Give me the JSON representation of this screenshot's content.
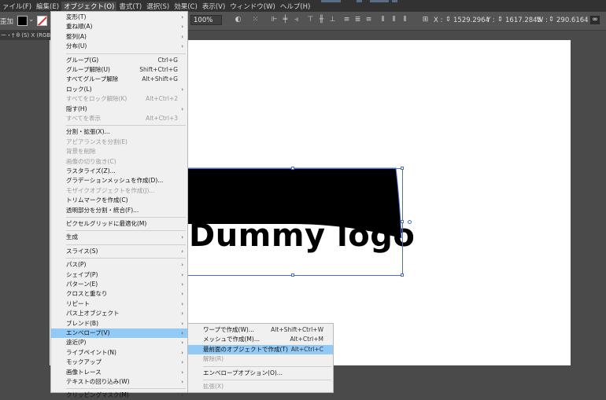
{
  "menubar": {
    "items": [
      {
        "label": "ァイル(F)"
      },
      {
        "label": "編集(E)"
      },
      {
        "label": "オブジェクト(O)",
        "active": true
      },
      {
        "label": "書式(T)"
      },
      {
        "label": "選択(S)"
      },
      {
        "label": "効果(C)"
      },
      {
        "label": "表示(V)"
      },
      {
        "label": "ウィンドウ(W)"
      },
      {
        "label": "ヘルプ(H)"
      }
    ]
  },
  "controlbar": {
    "label_left": "歪加",
    "zoom": "100%",
    "x_label": "X :",
    "x_value": "1529.2964",
    "y_label": "Y :",
    "y_value": "1617.2845",
    "w_label": "W :",
    "w_value": "290.6164"
  },
  "doc_tab": {
    "label": "ー・† θ (S) X (RGB/ブ"
  },
  "artwork": {
    "text": "Dummy logo",
    "shape_color": "#000000",
    "selection_color": "#4a6cd4"
  },
  "object_menu": {
    "items": [
      {
        "label": "変形(T)",
        "submenu": true
      },
      {
        "label": "重ね順(A)",
        "submenu": true
      },
      {
        "label": "整列(A)",
        "submenu": true
      },
      {
        "label": "分布(U)",
        "submenu": true
      },
      {
        "sep": true
      },
      {
        "label": "グループ(G)",
        "shortcut": "Ctrl+G"
      },
      {
        "label": "グループ解除(U)",
        "shortcut": "Shift+Ctrl+G"
      },
      {
        "label": "すべてグループ解除",
        "shortcut": "Alt+Shift+G"
      },
      {
        "label": "ロック(L)",
        "submenu": true
      },
      {
        "label": "すべてをロック解除(K)",
        "shortcut": "Alt+Ctrl+2",
        "disabled": true
      },
      {
        "label": "隠す(H)",
        "submenu": true
      },
      {
        "label": "すべてを表示",
        "shortcut": "Alt+Ctrl+3",
        "disabled": true
      },
      {
        "sep": true
      },
      {
        "label": "分割・拡張(X)..."
      },
      {
        "label": "アピアランスを分割(E)",
        "disabled": true
      },
      {
        "label": "背景を削除",
        "disabled": true
      },
      {
        "label": "画像の切り抜き(C)",
        "disabled": true
      },
      {
        "label": "ラスタライズ(Z)..."
      },
      {
        "label": "グラデーションメッシュを作成(D)..."
      },
      {
        "label": "モザイクオブジェクトを作成(J)...",
        "disabled": true
      },
      {
        "label": "トリムマークを作成(C)"
      },
      {
        "label": "透明部分を分割・統合(F)..."
      },
      {
        "sep": true
      },
      {
        "label": "ピクセルグリッドに最適化(M)"
      },
      {
        "sep": true
      },
      {
        "label": "生成",
        "submenu": true
      },
      {
        "sep": true
      },
      {
        "label": "スライス(S)",
        "submenu": true
      },
      {
        "sep": true
      },
      {
        "label": "パス(P)",
        "submenu": true
      },
      {
        "label": "シェイプ(P)",
        "submenu": true
      },
      {
        "label": "パターン(E)",
        "submenu": true
      },
      {
        "label": "クロスと重なり",
        "submenu": true
      },
      {
        "label": "リピート",
        "submenu": true
      },
      {
        "label": "パス上オブジェクト",
        "submenu": true
      },
      {
        "label": "ブレンド(B)",
        "submenu": true
      },
      {
        "label": "エンベロープ(V)",
        "submenu": true,
        "highlight": true
      },
      {
        "label": "遠近(P)",
        "submenu": true
      },
      {
        "label": "ライブペイント(N)",
        "submenu": true
      },
      {
        "label": "モックアップ",
        "submenu": true
      },
      {
        "label": "画像トレース",
        "submenu": true
      },
      {
        "label": "テキストの回り込み(W)",
        "submenu": true
      },
      {
        "sep": true
      },
      {
        "label": "クリッピングマスク(M)",
        "submenu": true
      }
    ]
  },
  "envelope_submenu": {
    "items": [
      {
        "label": "ワープで作成(W)...",
        "shortcut": "Alt+Shift+Ctrl+W"
      },
      {
        "label": "メッシュで作成(M)...",
        "shortcut": "Alt+Ctrl+M"
      },
      {
        "label": "最前面のオブジェクトで作成(T)",
        "shortcut": "Alt+Ctrl+C",
        "highlight": true
      },
      {
        "label": "解除(R)",
        "disabled": true
      },
      {
        "sep": true
      },
      {
        "label": "エンベロープオプション(O)..."
      },
      {
        "sep": true
      },
      {
        "label": "拡張(X)",
        "disabled": true
      }
    ]
  }
}
